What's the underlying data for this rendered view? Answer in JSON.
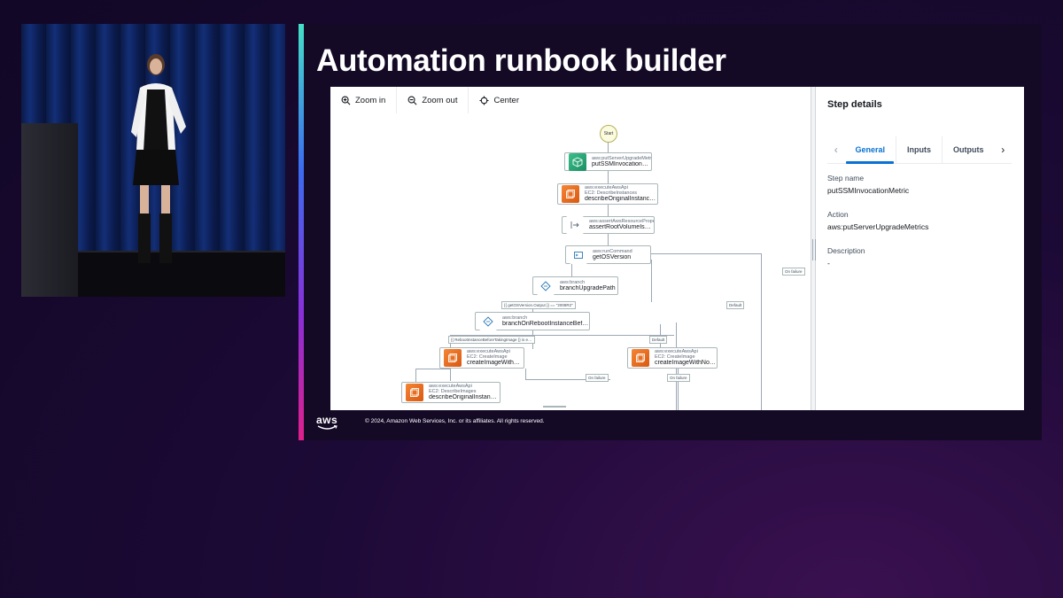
{
  "slide": {
    "title": "Automation runbook builder",
    "copyright": "© 2024, Amazon Web Services, Inc. or its affiliates. All rights reserved.",
    "logo_text": "aws"
  },
  "toolbar": {
    "zoom_in": "Zoom in",
    "zoom_out": "Zoom out",
    "center": "Center",
    "icons": [
      "zoom-in-icon",
      "zoom-out-icon",
      "center-icon"
    ]
  },
  "graph": {
    "start_label": "Start",
    "nodes": [
      {
        "type": "aws:putServerUpgradeMetrics",
        "sub": "",
        "name": "putSSMInvocationMetric",
        "icon": "cube-icon"
      },
      {
        "type": "aws:executeAwsApi",
        "sub": "EC2: DescribeInstances",
        "name": "describeOriginalInstanceDetails",
        "icon": "ec2-api-icon"
      },
      {
        "type": "aws:assertAwsResourceProperty",
        "sub": "",
        "name": "assertRootVolumeIsEbs",
        "icon": "assert-arrow-icon"
      },
      {
        "type": "aws:runCommand",
        "sub": "",
        "name": "getOSVersion",
        "icon": "run-command-icon"
      },
      {
        "type": "aws:branch",
        "sub": "",
        "name": "branchUpgradePath",
        "icon": "branch-icon"
      },
      {
        "type": "aws:branch",
        "sub": "",
        "name": "branchOnRebootInstanceBeforeTakin…",
        "icon": "branch-icon"
      },
      {
        "type": "aws:executeAwsApi",
        "sub": "EC2: CreateImage",
        "name": "createImageWithReboot",
        "icon": "ec2-api-icon"
      },
      {
        "type": "aws:executeAwsApi",
        "sub": "EC2: CreateImage",
        "name": "createImageWithNoReboot",
        "icon": "ec2-api-icon"
      },
      {
        "type": "aws:executeAwsApi",
        "sub": "EC2: DescribeImages",
        "name": "describeOriginalInstanceImage",
        "icon": "ec2-api-icon"
      }
    ],
    "edge_labels": [
      "On failure",
      "Default",
      "{{ getOSVersion.Output }} == \"2008R2\"",
      "{{ RebootInstanceBeforeTakingImage }} is e…",
      "Default",
      "On failure",
      "On failure",
      ""
    ]
  },
  "panel": {
    "title": "Step details",
    "tabs": [
      "General",
      "Inputs",
      "Outputs"
    ],
    "active_tab": "General",
    "step_name_label": "Step name",
    "step_name_value": "putSSMInvocationMetric",
    "action_label": "Action",
    "action_value": "aws:putServerUpgradeMetrics",
    "description_label": "Description",
    "description_value": "-"
  },
  "colors": {
    "accent": "#0972d3",
    "ec2_orange": "#f58536",
    "metric_green": "#1a8f63",
    "background": "#1c0a36"
  }
}
